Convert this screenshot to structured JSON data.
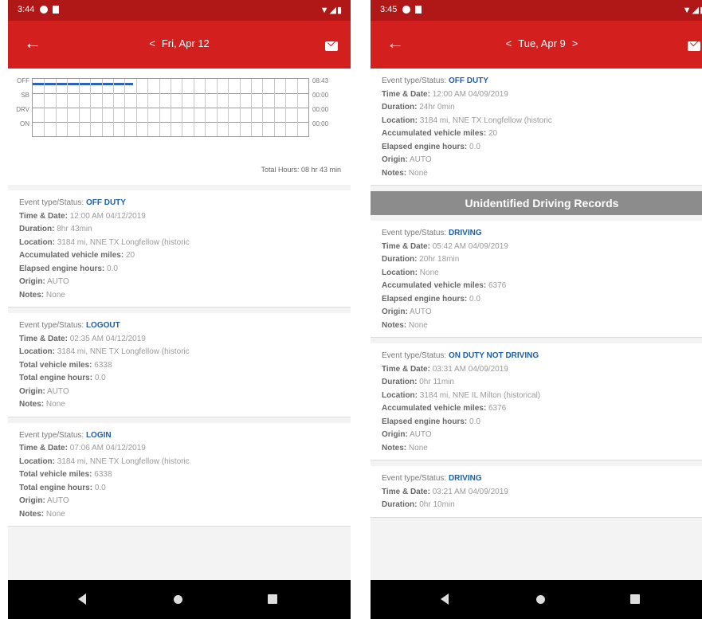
{
  "left": {
    "status_time": "3:44",
    "title_date": "Fri, Apr 12",
    "graph": {
      "y_labels": [
        "OFF",
        "SB",
        "DRV",
        "ON"
      ],
      "right_labels": [
        "08:43",
        "00:00",
        "00:00",
        "00:00"
      ],
      "total_hours": "Total Hours: 08 hr  43 min"
    },
    "events": [
      {
        "rows": [
          {
            "k": "Event type/Status:",
            "v": "OFF DUTY",
            "status": true,
            "light": true
          },
          {
            "k": "Time & Date:",
            "v": "12:00 AM 04/12/2019"
          },
          {
            "k": "Duration:",
            "v": "8hr 43min"
          },
          {
            "k": "Location:",
            "v": "3184 mi, NNE TX Longfellow (historic"
          },
          {
            "k": "Accumulated vehicle miles:",
            "v": "20"
          },
          {
            "k": "Elapsed engine hours:",
            "v": "0.0"
          },
          {
            "k": "Origin:",
            "v": "AUTO"
          },
          {
            "k": "Notes:",
            "v": "None"
          }
        ]
      },
      {
        "rows": [
          {
            "k": "Event type/Status:",
            "v": "LOGOUT",
            "status": true,
            "light": true
          },
          {
            "k": "Time & Date:",
            "v": "02:35 AM 04/12/2019"
          },
          {
            "k": "Location:",
            "v": "3184 mi, NNE TX Longfellow (historic"
          },
          {
            "k": "Total vehicle miles:",
            "v": "6338"
          },
          {
            "k": "Total engine hours:",
            "v": "0.0"
          },
          {
            "k": "Origin:",
            "v": "AUTO"
          },
          {
            "k": "Notes:",
            "v": "None"
          }
        ]
      },
      {
        "rows": [
          {
            "k": "Event type/Status:",
            "v": "LOGIN",
            "status": true,
            "light": true
          },
          {
            "k": "Time & Date:",
            "v": "07:06 AM 04/12/2019"
          },
          {
            "k": "Location:",
            "v": "3184 mi, NNE TX Longfellow (historic"
          },
          {
            "k": "Total vehicle miles:",
            "v": "6338"
          },
          {
            "k": "Total engine hours:",
            "v": "0.0"
          },
          {
            "k": "Origin:",
            "v": "AUTO"
          },
          {
            "k": "Notes:",
            "v": "None"
          }
        ]
      }
    ]
  },
  "right": {
    "status_time": "3:45",
    "title_date": "Tue, Apr 9",
    "events_top": [
      {
        "rows": [
          {
            "k": "Event type/Status:",
            "v": "OFF DUTY",
            "status": true,
            "light": true
          },
          {
            "k": "Time & Date:",
            "v": "12:00 AM 04/09/2019"
          },
          {
            "k": "Duration:",
            "v": "24hr 0min"
          },
          {
            "k": "Location:",
            "v": "3184 mi, NNE TX Longfellow (historic"
          },
          {
            "k": "Accumulated vehicle miles:",
            "v": "20"
          },
          {
            "k": "Elapsed engine hours:",
            "v": "0.0"
          },
          {
            "k": "Origin:",
            "v": "AUTO"
          },
          {
            "k": "Notes:",
            "v": "None"
          }
        ]
      }
    ],
    "section_title": "Unidentified Driving Records",
    "events_bottom": [
      {
        "rows": [
          {
            "k": "Event type/Status:",
            "v": "DRIVING",
            "status": true,
            "light": true
          },
          {
            "k": "Time & Date:",
            "v": "05:42 AM 04/09/2019"
          },
          {
            "k": "Duration:",
            "v": "20hr 18min"
          },
          {
            "k": "Location:",
            "v": "None"
          },
          {
            "k": "Accumulated vehicle miles:",
            "v": "6376"
          },
          {
            "k": "Elapsed engine hours:",
            "v": "0.0"
          },
          {
            "k": "Origin:",
            "v": "AUTO"
          },
          {
            "k": "Notes:",
            "v": "None"
          }
        ]
      },
      {
        "rows": [
          {
            "k": "Event type/Status:",
            "v": "ON DUTY NOT DRIVING",
            "status": true,
            "light": true
          },
          {
            "k": "Time & Date:",
            "v": "03:31 AM 04/09/2019"
          },
          {
            "k": "Duration:",
            "v": "0hr 11min"
          },
          {
            "k": "Location:",
            "v": "3184 mi, NNE IL Milton (historical)"
          },
          {
            "k": "Accumulated vehicle miles:",
            "v": "6376"
          },
          {
            "k": "Elapsed engine hours:",
            "v": "0.0"
          },
          {
            "k": "Origin:",
            "v": "AUTO"
          },
          {
            "k": "Notes:",
            "v": "None"
          }
        ]
      },
      {
        "rows": [
          {
            "k": "Event type/Status:",
            "v": "DRIVING",
            "status": true,
            "light": true
          },
          {
            "k": "Time & Date:",
            "v": "03:21 AM 04/09/2019"
          },
          {
            "k": "Duration:",
            "v": "0hr 10min"
          }
        ]
      }
    ]
  }
}
